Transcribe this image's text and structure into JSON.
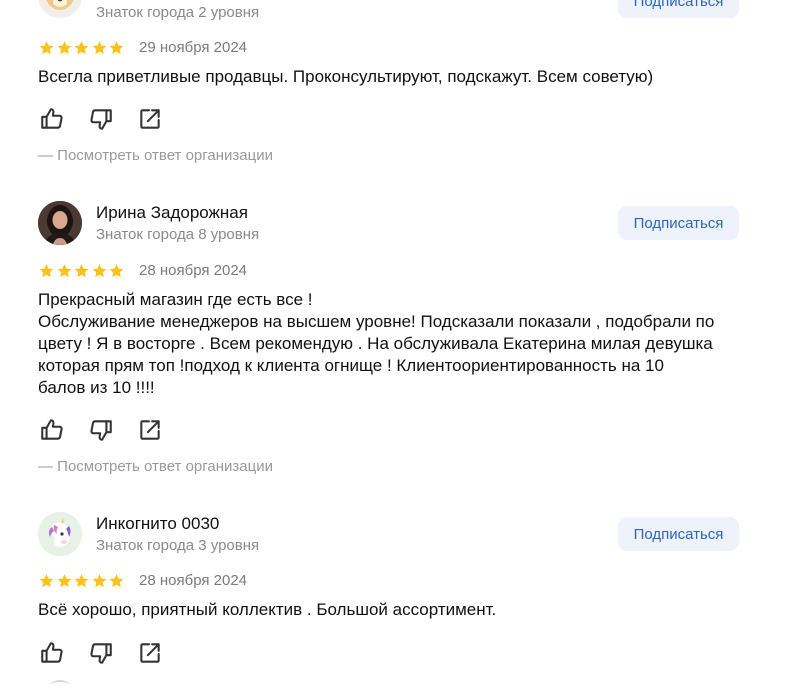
{
  "colors": {
    "star": "#fbc21b",
    "subscribe_bg": "#eef3fb",
    "subscribe_text": "#2f64b8",
    "muted": "#8a8a8a"
  },
  "reviews": [
    {
      "author": "",
      "level": "Знаток города 2 уровня",
      "subscribe_label": "Подписаться",
      "rating": 5,
      "date": "29 ноября 2024",
      "text_lines": [
        "Всегла приветливые продавцы. Проконсультируют, подскажут. Всем советую)"
      ],
      "reply_link": "— Посмотреть ответ организации",
      "avatar_icon": "animal-face-icon"
    },
    {
      "author": "Ирина Задорожная",
      "level": "Знаток города 8 уровня",
      "subscribe_label": "Подписаться",
      "rating": 5,
      "date": "28 ноября 2024",
      "text_lines": [
        "Прекрасный магазин где есть все !",
        "Обслуживание менеджеров на высшем уровне! Подсказали показали , подобрали по",
        "цвету ! Я в восторге . Всем рекомендую . На обслуживала Екатерина милая девушка",
        "которая прям топ !подход к клиента огнище ! Клиентоориентированность на 10",
        "балов из 10 !!!!"
      ],
      "reply_link": "— Посмотреть ответ организации",
      "avatar_icon": "user-photo"
    },
    {
      "author": "Инкогнито 0030",
      "level": "Знаток города 3 уровня",
      "subscribe_label": "Подписаться",
      "rating": 5,
      "date": "28 ноября 2024",
      "text_lines": [
        "Всё хорошо, приятный коллектив . Большой ассортимент."
      ],
      "avatar_icon": "unicorn-icon"
    }
  ]
}
